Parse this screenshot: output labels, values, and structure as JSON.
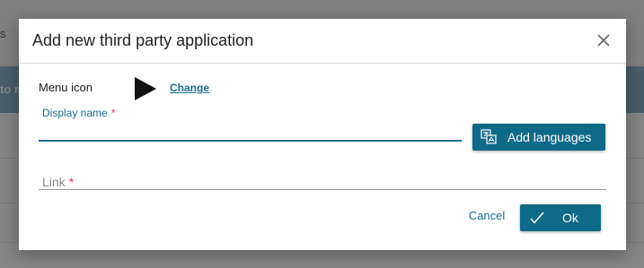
{
  "background": {
    "topbar_fragment": "s",
    "band_fragment": "to r"
  },
  "dialog": {
    "title": "Add new third party application",
    "close_icon": "close-icon",
    "menu_icon": {
      "label": "Menu icon",
      "preview_icon": "play-triangle-icon",
      "change_label": "Change"
    },
    "display_name": {
      "label": "Display name",
      "required_marker": "*",
      "value": ""
    },
    "add_languages": {
      "label": "Add languages",
      "icon": "translate-icon"
    },
    "link": {
      "label": "Link",
      "required_marker": "*",
      "value": ""
    },
    "actions": {
      "cancel_label": "Cancel",
      "ok_label": "Ok",
      "ok_icon": "checkmark-icon"
    }
  },
  "colors": {
    "accent": "#0f6a88",
    "link": "#1a6e8f",
    "required": "#d6336c",
    "overlay": "rgba(0,0,0,0.48)"
  }
}
